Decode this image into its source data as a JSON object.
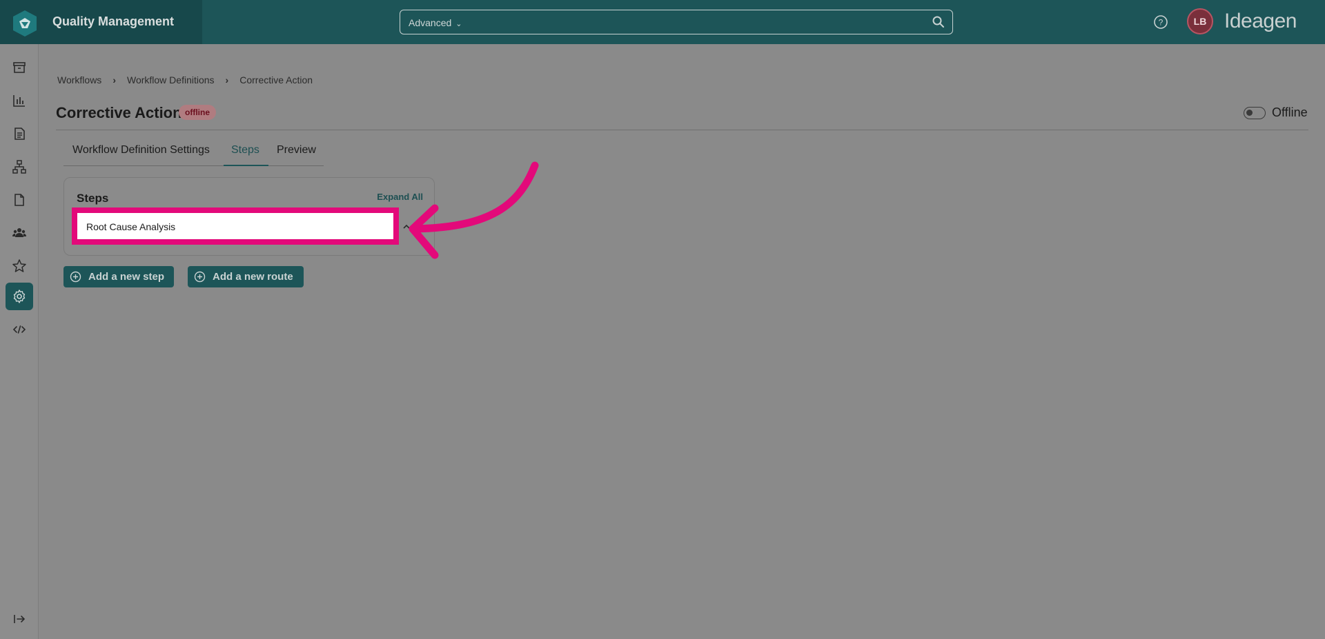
{
  "app": {
    "title": "Quality Management",
    "vendor": "Ideagen"
  },
  "search": {
    "mode": "Advanced",
    "placeholder": ""
  },
  "user": {
    "initials": "LB"
  },
  "breadcrumb": [
    "Workflows",
    "Workflow Definitions",
    "Corrective Action"
  ],
  "page": {
    "title": "Corrective Action",
    "status": "offline",
    "toggle_label": "Offline"
  },
  "tabs": [
    {
      "label": "Workflow Definition Settings"
    },
    {
      "label": "Steps"
    },
    {
      "label": "Preview"
    }
  ],
  "steps_panel": {
    "title": "Steps",
    "expand_all": "Expand All",
    "items": [
      {
        "label": "Root Cause Analysis"
      }
    ]
  },
  "actions": {
    "add_step": "Add a new step",
    "add_route": "Add a new route"
  },
  "sidebar": {
    "items": [
      {
        "icon": "archive-icon"
      },
      {
        "icon": "bar-chart-icon"
      },
      {
        "icon": "document-icon"
      },
      {
        "icon": "org-chart-icon"
      },
      {
        "icon": "file-icon"
      },
      {
        "icon": "users-icon"
      },
      {
        "icon": "star-icon"
      },
      {
        "icon": "gear-icon",
        "active": true
      },
      {
        "icon": "code-icon"
      },
      {
        "icon": "expand-sidebar-icon"
      }
    ]
  },
  "colors": {
    "topbar": "#1d5558",
    "accent": "#1d5558",
    "highlight": "#e3097a",
    "badge_text": "#6b0f1e"
  }
}
